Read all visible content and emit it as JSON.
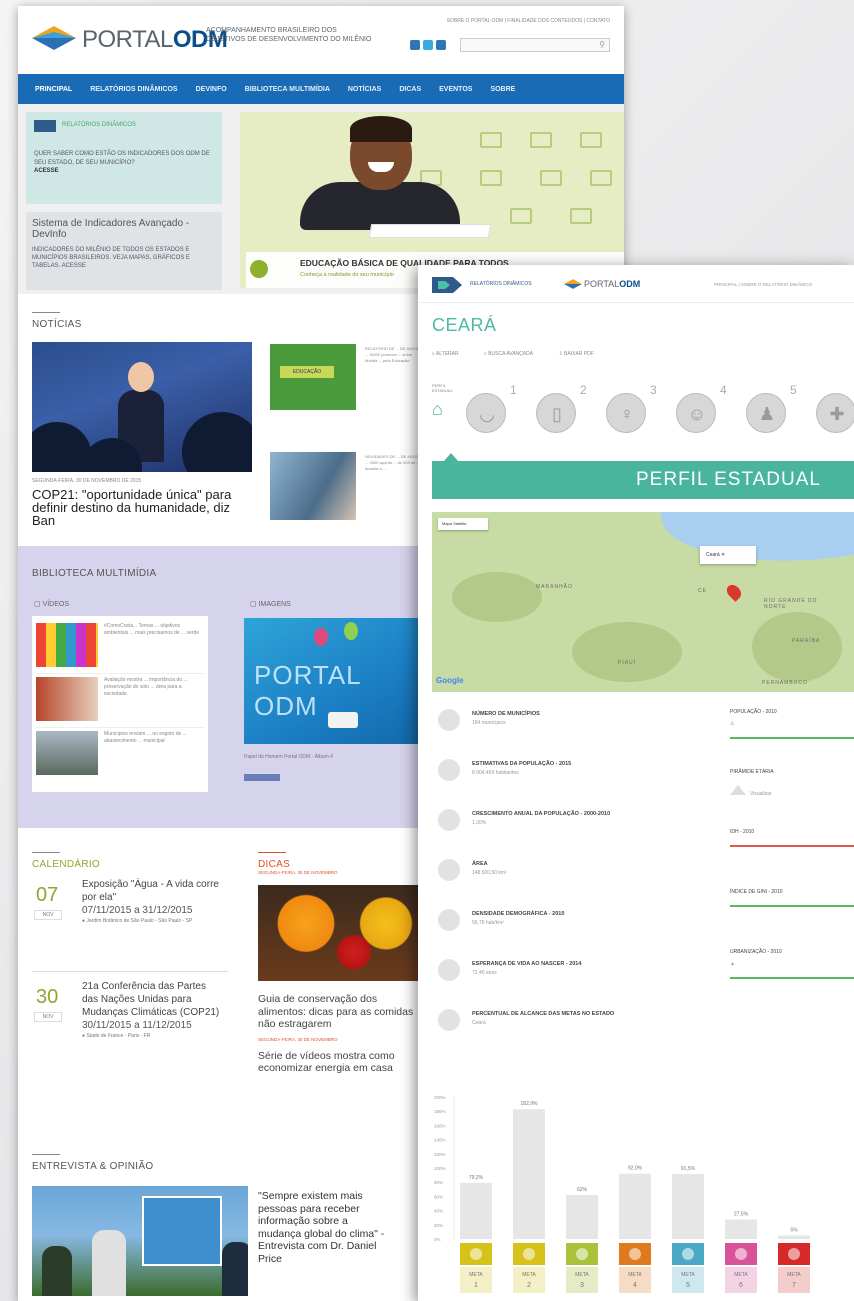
{
  "back": {
    "logo_text_a": "PORTAL",
    "logo_text_b": "ODM",
    "logo_sub": "ACOMPANHAMENTO BRASILEIRO DOS OBJETIVOS DE DESENVOLVIMENTO DO MILÊNIO",
    "toplinks": "SOBRE O PORTAL ODM | FINALIDADE DOS CONTEÚDOS | CONTATO",
    "nav": [
      "PRINCIPAL",
      "RELATÓRIOS DINÂMICOS",
      "DEVINFO",
      "BIBLIOTECA MULTIMÍDIA",
      "NOTÍCIAS",
      "DICAS",
      "EVENTOS",
      "SOBRE"
    ],
    "box1_title": "RELATÓRIOS DINÂMICOS",
    "box1_question": "QUER SABER COMO ESTÃO OS INDICADORES DOS ODM DE SEU ESTADO, DE SEU MUNICÍPIO?",
    "box1_cta": "ACESSE",
    "box2_title": "Sistema de Indicadores Avançado - DevInfo",
    "box2_desc": "INDICADORES DO MILÊNIO DE TODOS OS ESTADOS E MUNICÍPIOS BRASILEIROS. VEJA MAPAS, GRÁFICOS E TABELAS. ACESSE",
    "banner_title": "EDUCAÇÃO BÁSICA DE QUALIDADE PARA TODOS",
    "banner_sub": "Conheça a realidade do seu município",
    "noticias_title": "NOTÍCIAS",
    "news_caption": "SEGUNDA-FEIRA, 30 DE NOVEMBRO DE 2015",
    "news_headline": "COP21: \"oportunidade única\" para definir destino da humanidade, diz Ban",
    "thumb1_label": "EDUCAÇÃO",
    "mini1": "RELATÓRIO DE ... DE AGOSTO ... SASE promove ... sobre Mobiliz ... pela Educação",
    "mini2": "NOVIDADES DE ... DE AGOSTO ... OMS aponta ... de 303 mi ... durante o ...",
    "biblio_title": "BIBLIOTECA MULTIMÍDIA",
    "videos_label": "VÍDEOS",
    "imagens_label": "IMAGENS",
    "video_texts": [
      "#ComoCosta... Temas ... objetivos ambientais ... mais precisamos de ... verde",
      "Avaliação mostra ... importância do ... preservação do solo ... área para a sociedade",
      "Municípios enviam ... no esgoto de ... abastecimento ... municipal"
    ],
    "img_portal": "PORTAL ODM",
    "img_caption": "Papel do Homem Portal ODM - Álbum 4",
    "calendario_title": "CALENDÁRIO",
    "cal": [
      {
        "day": "07",
        "mon": "NOV",
        "title": "Exposição \"Água - A vida corre por ela\"",
        "date": "07/11/2015 a 31/12/2015",
        "loc": "Jardim Botânico de São Paulo - São Paulo - SP"
      },
      {
        "day": "30",
        "mon": "NOV",
        "title": "21a Conferência das Partes das Nações Unidas para Mudanças Climáticas (COP21)",
        "date": "30/11/2015 a 11/12/2015",
        "loc": "Stade de France - Paris - FR"
      }
    ],
    "dicas_title": "DICAS",
    "dicas_sub": "SEGUNDA-FEIRA, 30 DE NOVEMBRO",
    "dicas_t1": "Guia de conservação dos alimentos: dicas para as comidas não estragarem",
    "dicas_sub2": "SEGUNDA-FEIRA, 30 DE NOVEMBRO",
    "dicas_t2": "Série de vídeos mostra como economizar energia em casa",
    "entrevista_title": "ENTREVISTA & OPINIÃO",
    "entrevista_quote": "\"Sempre existem mais pessoas para receber informação sobre a mudança global do clima\" - Entrevista com Dr. Daniel Price"
  },
  "front": {
    "rel_label": "RELATÓRIOS DINÂMICOS",
    "portal_a": "PORTAL",
    "portal_b": "ODM",
    "links": "PRINCIPAL | SOBRE O RELATÓRIO DINÂMICO",
    "state": "CEARÁ",
    "tools": [
      "ALTERAR",
      "BUSCA AVANÇADA",
      "BAIXAR PDF"
    ],
    "home_label": "PERFIL ESTADUAL",
    "icon_nums": [
      "1",
      "2",
      "3",
      "4",
      "5"
    ],
    "perfil": "PERFIL ESTADUAL",
    "map": {
      "tab": "Mapa  Satélite",
      "popup": "Ceará  ✕",
      "labels": [
        "MARANHÃO",
        "PIAUÍ",
        "RIO GRANDE DO NORTE",
        "PARAÍBA",
        "PERNAMBUCO",
        "CE"
      ],
      "google": "Google"
    },
    "stats": [
      {
        "t": "NÚMERO DE MUNICÍPIOS",
        "v": "184 municípios"
      },
      {
        "t": "ESTIMATIVAS DA POPULAÇÃO - 2015",
        "v": "8.904.459 habitantes"
      },
      {
        "t": "CRESCIMENTO ANUAL DA POPULAÇÃO - 2000-2010",
        "v": "1,30%"
      },
      {
        "t": "ÁREA",
        "v": "148.920,50 km²"
      },
      {
        "t": "DENSIDADE DEMOGRÁFICA - 2010",
        "v": "56,76 hab/km²"
      },
      {
        "t": "ESPERANÇA DE VIDA AO NASCER - 2014",
        "v": "72,40 anos"
      },
      {
        "t": "PERCENTUAL DE ALCANCE DAS METAS NO ESTADO",
        "v": "Ceará"
      }
    ],
    "right": [
      {
        "t": "POPULAÇÃO - 2010",
        "v": "",
        "color": "#5cb85c"
      },
      {
        "t": "PIRÂMIDE ETÁRIA",
        "v": "Visualizar",
        "color": ""
      },
      {
        "t": "IDH - 2010",
        "v": "",
        "color": "#e05a4a"
      },
      {
        "t": "ÍNDICE DE GINI - 2010",
        "v": "",
        "color": "#5cb85c"
      },
      {
        "t": "URBANIZAÇÃO - 2010",
        "v": "",
        "color": "#5cb85c"
      }
    ]
  },
  "chart_data": {
    "type": "bar",
    "categories": [
      "META 1",
      "META 2",
      "META 3",
      "META 4",
      "META 5",
      "META 6",
      "META 7"
    ],
    "values": [
      79.2,
      182.9,
      62,
      92.0,
      91.5,
      27.5,
      5
    ],
    "data_labels": [
      "79,2%",
      "182,9%",
      "62%",
      "92,0%",
      "91,5%",
      "27,5%",
      "5%"
    ],
    "y_ticks": [
      "200%",
      "180%",
      "160%",
      "140%",
      "120%",
      "100%",
      "80%",
      "60%",
      "40%",
      "20%",
      "0%"
    ],
    "ylim": [
      0,
      200
    ],
    "colors": [
      "#d6c21a",
      "#d6c21a",
      "#a9c23a",
      "#e07a1e",
      "#4aa8c4",
      "#d9529a",
      "#d62a2a"
    ],
    "label_bg": [
      "#f3efc6",
      "#f3efc6",
      "#e3ecc6",
      "#f6dcc4",
      "#cfe8f0",
      "#f4d4e4",
      "#f4cccc"
    ],
    "title": "",
    "xlabel": "",
    "ylabel": ""
  }
}
